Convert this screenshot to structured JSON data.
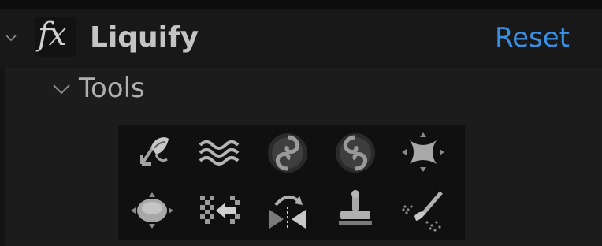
{
  "effect": {
    "icon_label": "fx",
    "name": "Liquify",
    "reset_label": "Reset"
  },
  "tools_group": {
    "label": "Tools"
  },
  "tools": [
    {
      "icon": "warp-tool-icon"
    },
    {
      "icon": "turbulence-tool-icon"
    },
    {
      "icon": "twirl-clockwise-tool-icon"
    },
    {
      "icon": "twirl-counterclockwise-tool-icon"
    },
    {
      "icon": "pucker-tool-icon"
    },
    {
      "icon": "bloat-tool-icon"
    },
    {
      "icon": "shift-pixels-tool-icon"
    },
    {
      "icon": "reflection-tool-icon"
    },
    {
      "icon": "clone-tool-icon"
    },
    {
      "icon": "reconstruction-tool-icon"
    }
  ],
  "colors": {
    "background": "#1d1d1d",
    "header": "#181818",
    "palette": "#101010",
    "text": "#c4c4c4",
    "accent": "#3b8fe0",
    "icon": "#9a9a9a"
  }
}
